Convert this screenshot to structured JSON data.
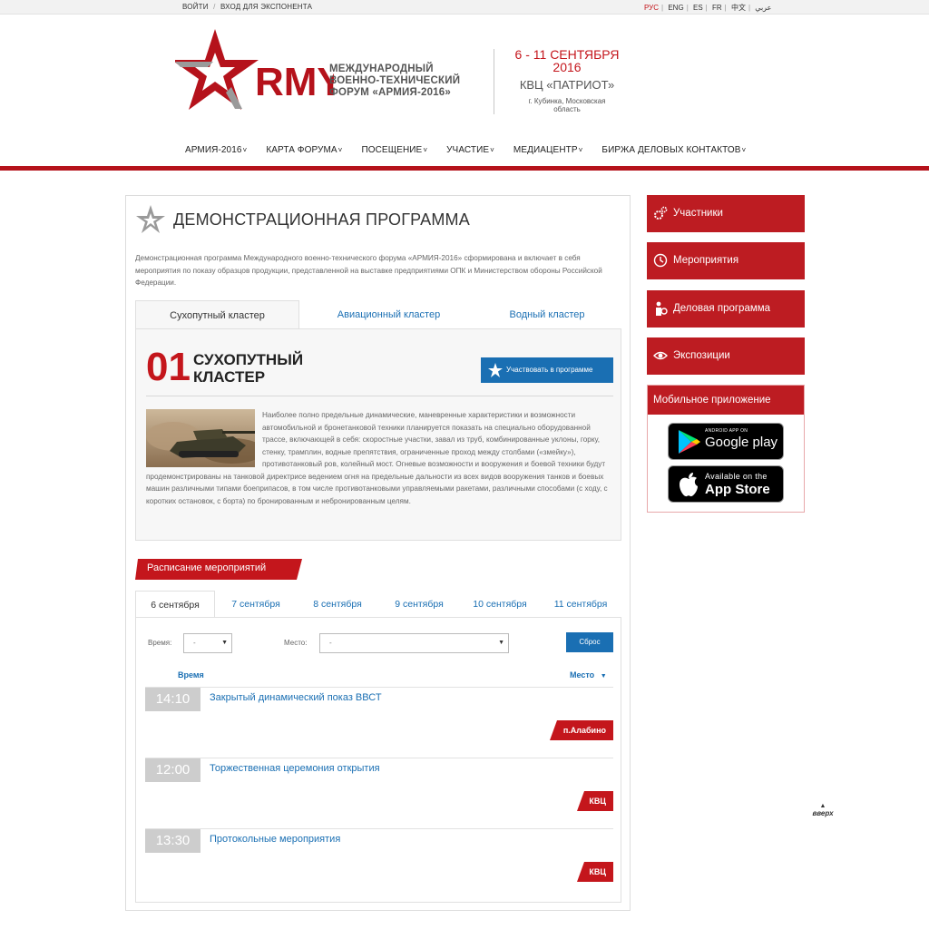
{
  "topbar": {
    "login": "ВОЙТИ",
    "sep": "/",
    "exhibitor_login": "ВХОД ДЛЯ ЭКСПОНЕНТА",
    "langs": [
      "РУС",
      "ENG",
      "ES",
      "FR",
      "中文",
      "عربي"
    ]
  },
  "header": {
    "logo_word": "RMY",
    "logo_line1": "МЕЖДУНАРОДНЫЙ",
    "logo_line2": "ВОЕННО-ТЕХНИЧЕСКИЙ",
    "logo_line3": "ФОРУМ «АРМИЯ-2016»",
    "dates_line1": "6 - 11 СЕНТЯБРЯ",
    "dates_line2": "2016",
    "venue": "КВЦ «ПАТРИОТ»",
    "city": "г. Кубинка, Московская область"
  },
  "menu": [
    "АРМИЯ-2016",
    "КАРТА ФОРУМА",
    "ПОСЕЩЕНИЕ",
    "УЧАСТИЕ",
    "МЕДИАЦЕНТР",
    "БИРЖА ДЕЛОВЫХ КОНТАКТОВ"
  ],
  "main": {
    "title": "ДЕМОНСТРАЦИОННАЯ ПРОГРАММА",
    "intro": "Демонстрационная программа Международного военно-технического форума «АРМИЯ-2016» сформирована и включает в себя мероприятия по показу образцов продукции, представленной на выставке предприятиями ОПК и Министерством обороны Российской Федерации.",
    "tabs": [
      "Сухопутный кластер",
      "Авиационный кластер",
      "Водный кластер"
    ],
    "cluster": {
      "num": "01",
      "name_line1": "СУХОПУТНЫЙ",
      "name_line2": "КЛАСТЕР",
      "participate": "Участвовать в программе",
      "text": "Наиболее полно предельные динамические, маневренные характеристики и возможности автомобильной и бронетанковой техники планируется показать на специально оборудованной трассе, включающей в себя: скоростные участки, завал из труб, комбинированные уклоны, горку, стенку, трамплин, водные препятствия, ограниченные проход между столбами («змейку»), противотанковый ров, колейный мост. Огневые возможности и вооружения и боевой техники будут продемонстрированы на танковой директрисе ведением огня на предельные дальности из всех видов вооружения танков и боевых машин различными типами боеприпасов, в том числе противотанковыми управляемыми ракетами, различными способами (с ходу, с коротких остановок, с борта) по бронированным и небронированным целям."
    },
    "schedule": {
      "label": "Расписание мероприятий",
      "days": [
        "6 сентября",
        "7 сентября",
        "8 сентября",
        "9 сентября",
        "10 сентября",
        "11 сентября"
      ],
      "time_label": "Время:",
      "time_value": "-",
      "place_label": "Место:",
      "place_value": "-",
      "reset": "Сброс",
      "col_time": "Время",
      "col_place": "Место",
      "events": [
        {
          "time": "14:10",
          "title": "Закрытый динамический показ ВВСТ",
          "place": "п.Алабино"
        },
        {
          "time": "12:00",
          "title": "Торжественная церемония открытия",
          "place": "КВЦ"
        },
        {
          "time": "13:30",
          "title": "Протокольные мероприятия",
          "place": "КВЦ"
        }
      ]
    }
  },
  "sidebar": {
    "items": [
      "Участники",
      "Мероприятия",
      "Деловая программа",
      "Экспозиции"
    ],
    "mobile_title": "Мобильное приложение",
    "google_small": "ANDROID APP ON",
    "google_big": "Google play",
    "apple_small": "Available on the",
    "apple_big": "App Store"
  },
  "totop": "вверх",
  "colors": {
    "brand_red": "#bd1c22",
    "link_blue": "#1a6fb3"
  }
}
